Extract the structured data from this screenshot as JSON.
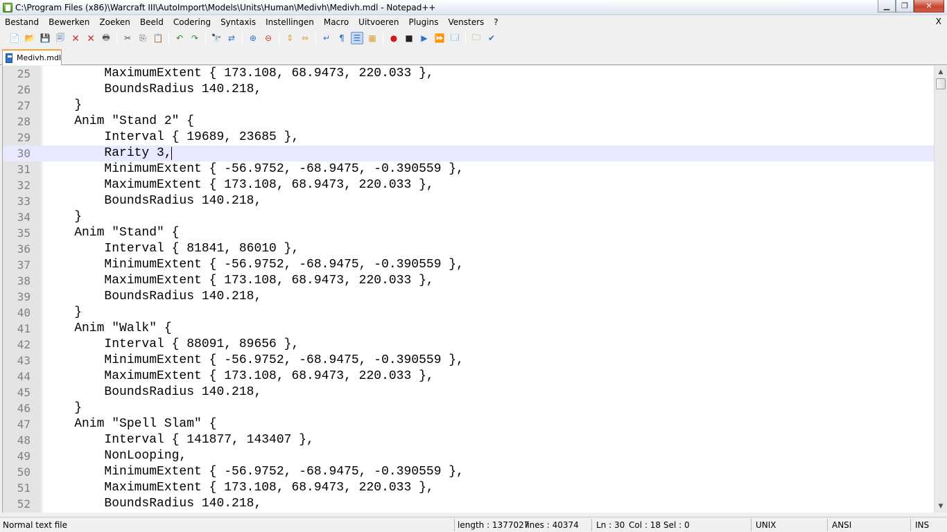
{
  "window": {
    "title": "C:\\Program Files (x86)\\Warcraft III\\AutoImport\\Models\\Units\\Human\\Medivh\\Medivh.mdl - Notepad++",
    "minimize_glyph": "▁",
    "maximize_glyph": "❐",
    "close_glyph": "✕"
  },
  "menu": {
    "items": [
      "Bestand",
      "Bewerken",
      "Zoeken",
      "Beeld",
      "Codering",
      "Syntaxis",
      "Instellingen",
      "Macro",
      "Uitvoeren",
      "Plugins",
      "Vensters",
      "?"
    ],
    "close_glyph": "X"
  },
  "toolbar": {
    "buttons": [
      {
        "icon": "new-file-icon",
        "glyph": "📄",
        "color": "#3a8a2c"
      },
      {
        "icon": "open-file-icon",
        "glyph": "📂",
        "color": "#d8a23a"
      },
      {
        "icon": "save-icon",
        "glyph": "💾",
        "color": "#4a6fa5"
      },
      {
        "icon": "save-all-icon",
        "glyph": "🗐",
        "color": "#4a6fa5"
      },
      {
        "icon": "close-file-icon",
        "glyph": "🗙",
        "color": "#c0392b"
      },
      {
        "icon": "close-all-icon",
        "glyph": "🗙",
        "color": "#c0392b"
      },
      {
        "icon": "print-icon",
        "glyph": "🖶",
        "color": "#555555"
      },
      {
        "sep": true
      },
      {
        "icon": "cut-icon",
        "glyph": "✂",
        "color": "#555555"
      },
      {
        "icon": "copy-icon",
        "glyph": "⎘",
        "color": "#555555"
      },
      {
        "icon": "paste-icon",
        "glyph": "📋",
        "color": "#b07a2a"
      },
      {
        "sep": true
      },
      {
        "icon": "undo-icon",
        "glyph": "↶",
        "color": "#2f8a2f"
      },
      {
        "icon": "redo-icon",
        "glyph": "↷",
        "color": "#2f8a2f"
      },
      {
        "sep": true
      },
      {
        "icon": "find-icon",
        "glyph": "🔭",
        "color": "#333333"
      },
      {
        "icon": "replace-icon",
        "glyph": "⇄",
        "color": "#2b74c7"
      },
      {
        "sep": true
      },
      {
        "icon": "zoom-in-icon",
        "glyph": "⊕",
        "color": "#2b74c7"
      },
      {
        "icon": "zoom-out-icon",
        "glyph": "⊖",
        "color": "#c0392b"
      },
      {
        "sep": true
      },
      {
        "icon": "sync-vertical-icon",
        "glyph": "⇕",
        "color": "#d8a23a"
      },
      {
        "icon": "sync-horizontal-icon",
        "glyph": "⇔",
        "color": "#d8a23a"
      },
      {
        "sep": true
      },
      {
        "icon": "word-wrap-icon",
        "glyph": "↵",
        "color": "#2b74c7"
      },
      {
        "icon": "show-all-chars-icon",
        "glyph": "¶",
        "color": "#2b74c7"
      },
      {
        "icon": "indent-guide-icon",
        "glyph": "☰",
        "color": "#2b74c7",
        "active": true
      },
      {
        "icon": "user-lang-icon",
        "glyph": "▦",
        "color": "#d8a23a"
      },
      {
        "sep": true
      },
      {
        "icon": "record-macro-icon",
        "glyph": "●",
        "color": "#d11a1a"
      },
      {
        "icon": "stop-macro-icon",
        "glyph": "■",
        "color": "#222222"
      },
      {
        "icon": "play-macro-icon",
        "glyph": "▶",
        "color": "#2b74c7"
      },
      {
        "icon": "run-macro-multiple-icon",
        "glyph": "⏩",
        "color": "#2b74c7"
      },
      {
        "icon": "save-macro-icon",
        "glyph": "🗔",
        "color": "#2b74c7"
      },
      {
        "sep": true
      },
      {
        "icon": "folder-workspace-icon",
        "glyph": "🗀",
        "color": "#b07a2a"
      },
      {
        "icon": "spell-check-icon",
        "glyph": "✔",
        "color": "#2b74c7"
      }
    ]
  },
  "tab": {
    "label": "Medivh.mdl"
  },
  "editor": {
    "current_line": 30,
    "lines": [
      {
        "num": "25",
        "text": "        MaximumExtent { 173.108, 68.9473, 220.033 },"
      },
      {
        "num": "26",
        "text": "        BoundsRadius 140.218,"
      },
      {
        "num": "27",
        "text": "    }"
      },
      {
        "num": "28",
        "text": "    Anim \"Stand 2\" {"
      },
      {
        "num": "29",
        "text": "        Interval { 19689, 23685 },"
      },
      {
        "num": "30",
        "text": "        Rarity 3,"
      },
      {
        "num": "31",
        "text": "        MinimumExtent { -56.9752, -68.9475, -0.390559 },"
      },
      {
        "num": "32",
        "text": "        MaximumExtent { 173.108, 68.9473, 220.033 },"
      },
      {
        "num": "33",
        "text": "        BoundsRadius 140.218,"
      },
      {
        "num": "34",
        "text": "    }"
      },
      {
        "num": "35",
        "text": "    Anim \"Stand\" {"
      },
      {
        "num": "36",
        "text": "        Interval { 81841, 86010 },"
      },
      {
        "num": "37",
        "text": "        MinimumExtent { -56.9752, -68.9475, -0.390559 },"
      },
      {
        "num": "38",
        "text": "        MaximumExtent { 173.108, 68.9473, 220.033 },"
      },
      {
        "num": "39",
        "text": "        BoundsRadius 140.218,"
      },
      {
        "num": "40",
        "text": "    }"
      },
      {
        "num": "41",
        "text": "    Anim \"Walk\" {"
      },
      {
        "num": "42",
        "text": "        Interval { 88091, 89656 },"
      },
      {
        "num": "43",
        "text": "        MinimumExtent { -56.9752, -68.9475, -0.390559 },"
      },
      {
        "num": "44",
        "text": "        MaximumExtent { 173.108, 68.9473, 220.033 },"
      },
      {
        "num": "45",
        "text": "        BoundsRadius 140.218,"
      },
      {
        "num": "46",
        "text": "    }"
      },
      {
        "num": "47",
        "text": "    Anim \"Spell Slam\" {"
      },
      {
        "num": "48",
        "text": "        Interval { 141877, 143407 },"
      },
      {
        "num": "49",
        "text": "        NonLooping,"
      },
      {
        "num": "50",
        "text": "        MinimumExtent { -56.9752, -68.9475, -0.390559 },"
      },
      {
        "num": "51",
        "text": "        MaximumExtent { 173.108, 68.9473, 220.033 },"
      },
      {
        "num": "52",
        "text": "        BoundsRadius 140.218,"
      }
    ]
  },
  "statusbar": {
    "file_type": "Normal text file",
    "length": "length : 1377027",
    "lines": "lines : 40374",
    "ln": "Ln : 30",
    "col": "Col : 18",
    "sel": "Sel : 0",
    "eol": "UNIX",
    "encoding": "ANSI",
    "mode": "INS"
  },
  "colors": {
    "tab_accent": "#f9a13a",
    "current_line_bg": "#e8e8ff",
    "gutter_bg": "#e4e4e4",
    "line_number": "#808080"
  }
}
